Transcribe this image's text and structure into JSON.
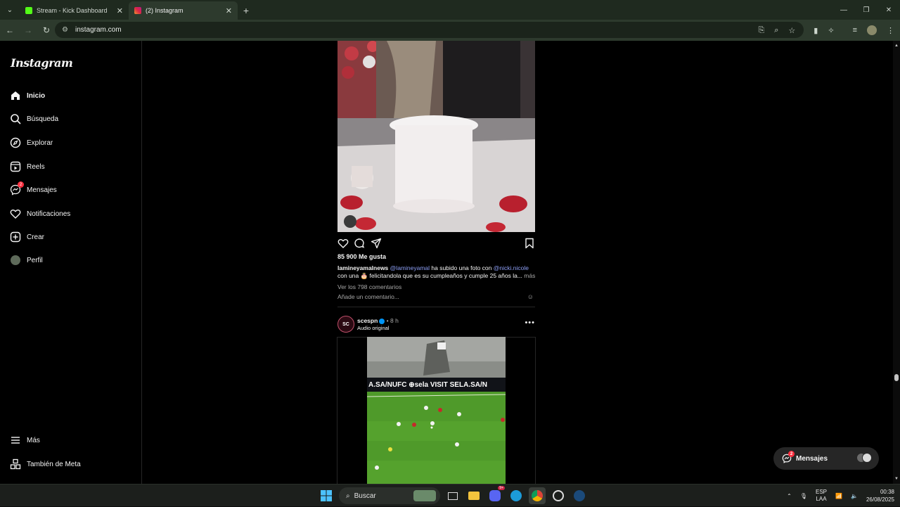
{
  "browser": {
    "tabs": [
      {
        "title": "Stream - Kick Dashboard",
        "favicon_color": "#53fc18",
        "active": false
      },
      {
        "title": "(2) Instagram",
        "favicon_color": "#e1306c",
        "active": true
      }
    ],
    "url": "instagram.com"
  },
  "sidebar": {
    "logo": "Instagram",
    "items": [
      {
        "label": "Inicio",
        "icon": "home-icon"
      },
      {
        "label": "Búsqueda",
        "icon": "search-icon"
      },
      {
        "label": "Explorar",
        "icon": "compass-icon"
      },
      {
        "label": "Reels",
        "icon": "reels-icon"
      },
      {
        "label": "Mensajes",
        "icon": "messenger-icon",
        "badge": "2"
      },
      {
        "label": "Notificaciones",
        "icon": "heart-icon"
      },
      {
        "label": "Crear",
        "icon": "plus-square-icon"
      },
      {
        "label": "Perfil",
        "icon": "avatar"
      }
    ],
    "bottom": [
      {
        "label": "Más",
        "icon": "menu-icon"
      },
      {
        "label": "También de Meta",
        "icon": "meta-grid-icon"
      }
    ]
  },
  "post1": {
    "likes": "85 900 Me gusta",
    "username": "lamineyamalnews",
    "mention1": "@lamineyamal",
    "text1": " ha subido una foto con ",
    "mention2": "@nicki.nicole",
    "text2": " con una 🎂 felicitandola que es su cumpleaños y cumple 25 años la...",
    "more": "más",
    "view_comments": "Ver los 798 comentarios",
    "add_comment_placeholder": "Añade un comentario...",
    "cake_emoji": "🎂💕"
  },
  "post2": {
    "username": "scespn",
    "avatar_text": "SC",
    "time": "8 h",
    "audio": "Audio original",
    "stadium_ads": "A.SA/NUFC  ⊕sela  VISIT SELA.SA/N"
  },
  "messages_pill": {
    "label": "Mensajes",
    "badge": "2"
  },
  "taskbar": {
    "search_placeholder": "Buscar",
    "discord_badge": "9+",
    "lang_top": "ESP",
    "lang_bottom": "LAA",
    "time": "00:38",
    "date": "26/08/2025"
  }
}
